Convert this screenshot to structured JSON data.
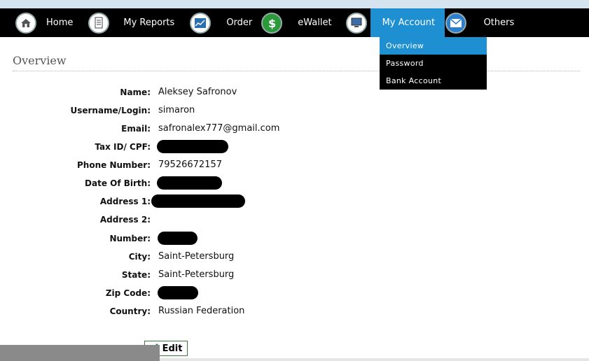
{
  "nav": {
    "items": [
      {
        "label": "Home",
        "icon": "home-icon"
      },
      {
        "label": "My Reports",
        "icon": "document-icon"
      },
      {
        "label": "Order",
        "icon": "chart-icon"
      },
      {
        "label": "eWallet",
        "icon": "dollar-icon"
      },
      {
        "label": "My Account",
        "icon": "computer-icon"
      },
      {
        "label": "Others",
        "icon": "mail-icon"
      }
    ],
    "active": "My Account"
  },
  "dropdown": {
    "items": [
      "Overview",
      "Password",
      "Bank Account"
    ],
    "active": "Overview"
  },
  "page": {
    "title": "Overview"
  },
  "profile": {
    "name_label": "Name:",
    "name": "Aleksey Safronov",
    "username_label": "Username/Login:",
    "username": "simaron",
    "email_label": "Email:",
    "email": "safronalex777@gmail.com",
    "taxid_label": "Tax ID/ CPF:",
    "phone_label": "Phone Number:",
    "phone": "79526672157",
    "dob_label": "Date Of Birth:",
    "address1_label": "Address 1:",
    "address2_label": "Address 2:",
    "number_label": "Number:",
    "city_label": "City:",
    "city": "Saint-Petersburg",
    "state_label": "State:",
    "state": "Saint-Petersburg",
    "zip_label": "Zip Code:",
    "country_label": "Country:",
    "country": "Russian Federation"
  },
  "actions": {
    "edit_label": "Edit"
  },
  "colors": {
    "accent": "#1e90d2",
    "navbar": "#000000"
  }
}
